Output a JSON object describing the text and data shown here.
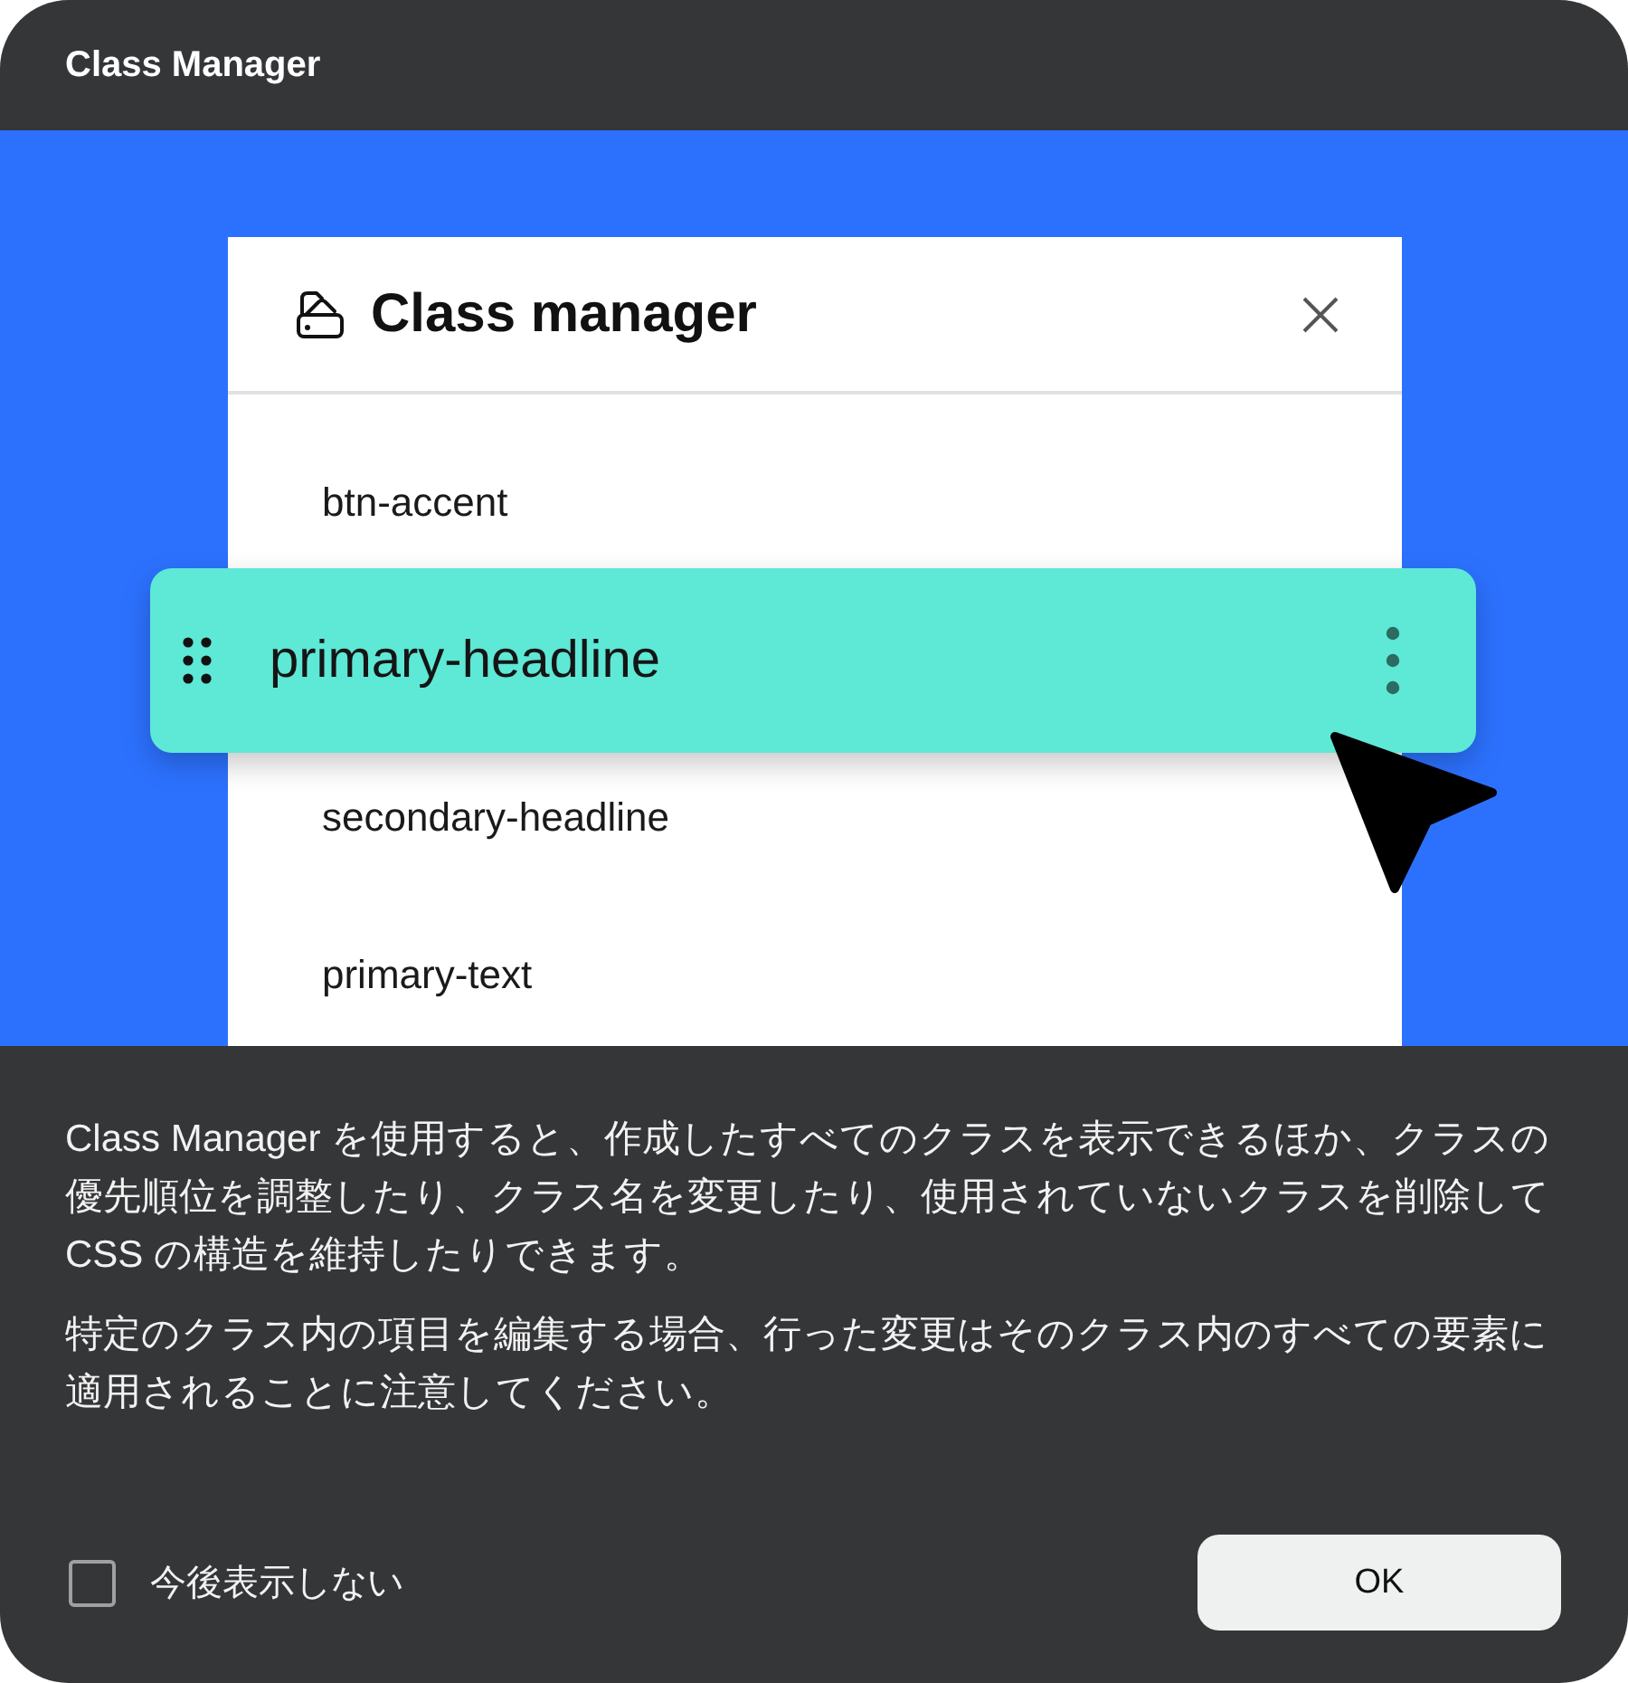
{
  "dialog": {
    "title": "Class Manager"
  },
  "illustration": {
    "panel": {
      "title": "Class manager",
      "items": [
        {
          "label": "btn-accent",
          "kind": "item"
        },
        {
          "label": "primary-headline",
          "kind": "dragged"
        },
        {
          "label": "secondary-headline",
          "kind": "item"
        },
        {
          "label": "primary-text",
          "kind": "item"
        }
      ]
    }
  },
  "description": [
    "Class Manager を使用すると、作成したすべてのクラスを表示できるほか、クラスの優先順位を調整したり、クラス名を変更したり、使用されていないクラスを削除して CSS の構造を維持したりできます。",
    "特定のクラス内の項目を編集する場合、行った変更はそのクラス内のすべての要素に適用されることに注意してください。"
  ],
  "dont_show_again": {
    "label": "今後表示しない",
    "checked": false
  },
  "buttons": [
    {
      "label": "OK"
    }
  ]
}
